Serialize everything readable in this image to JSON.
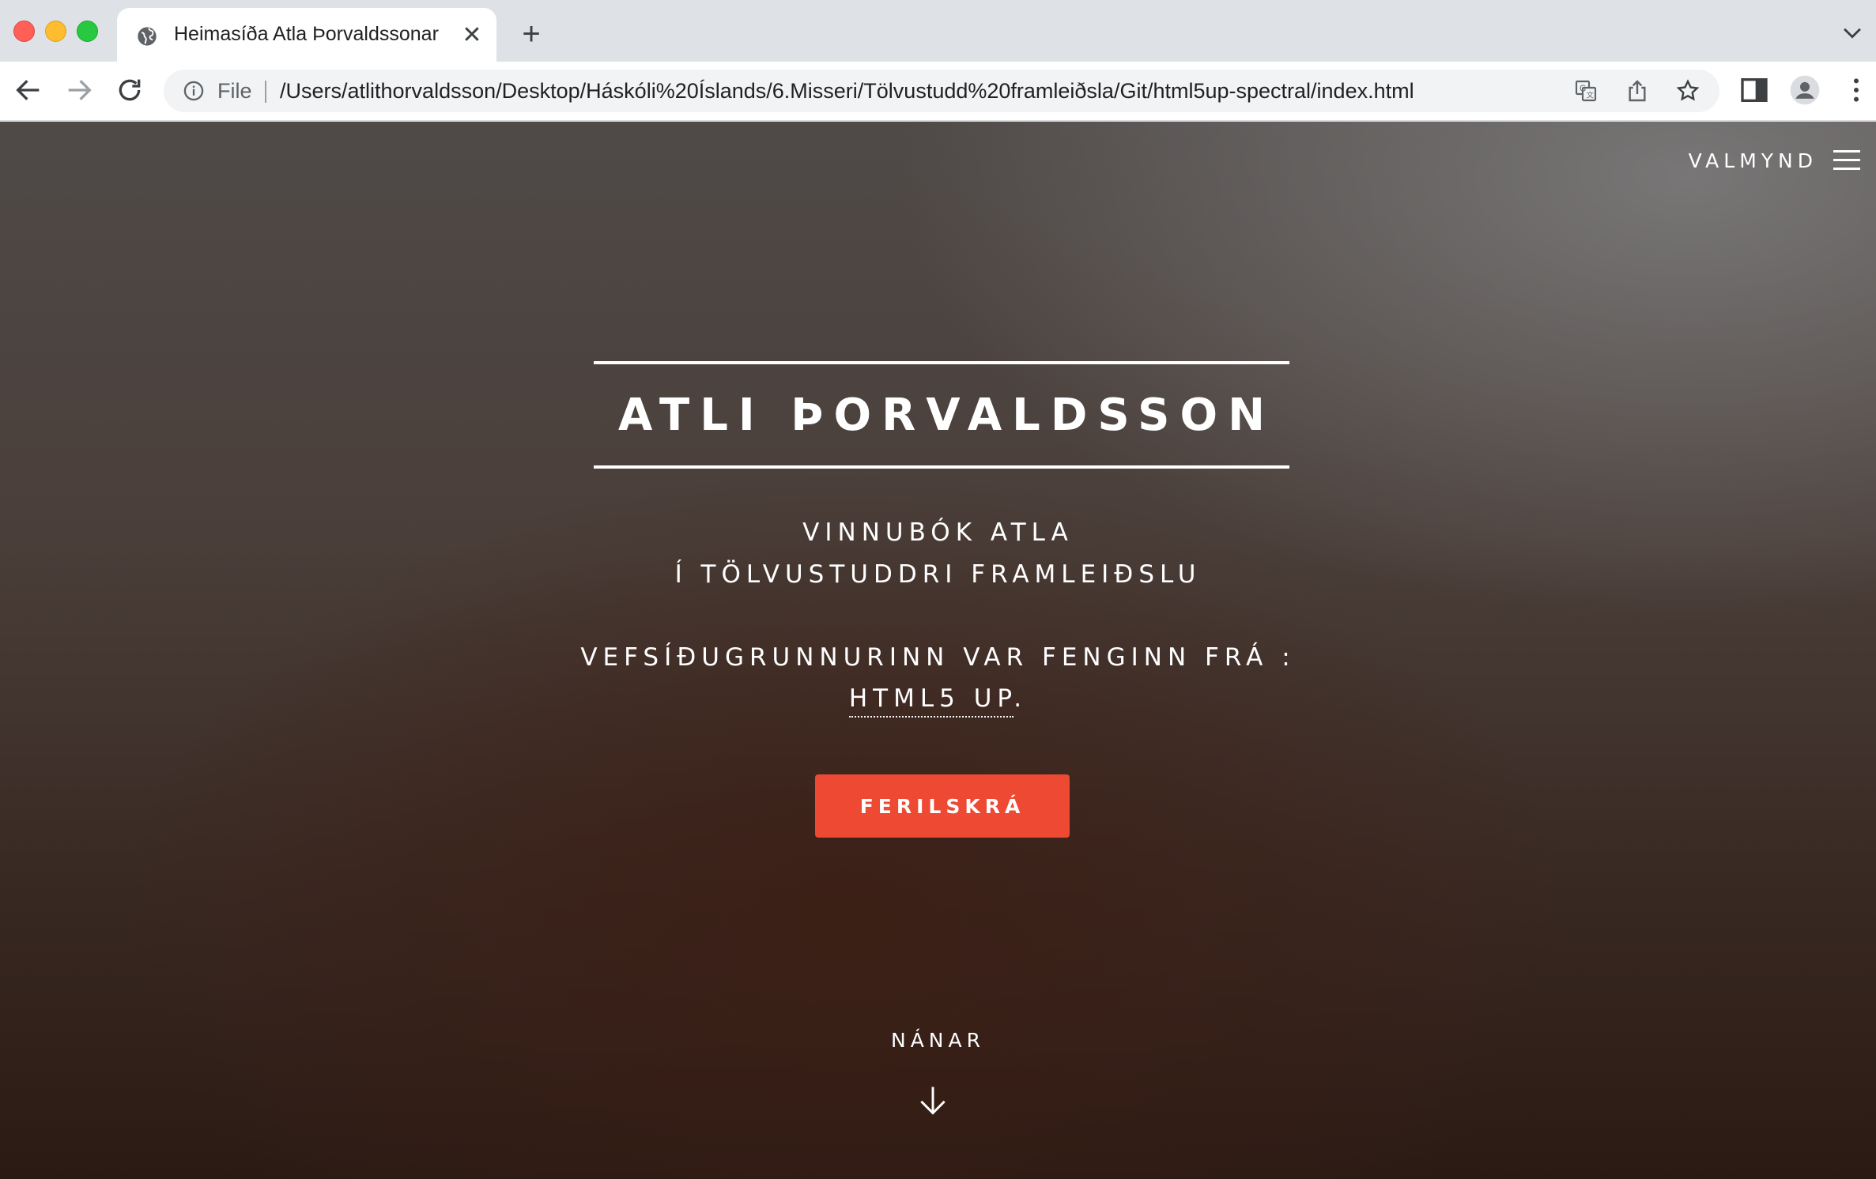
{
  "browser": {
    "tab_title": "Heimasíða Atla Þorvaldssonar",
    "tab_close": "✕",
    "new_tab": "+",
    "address_scheme": "File",
    "url": "/Users/atlithorvaldsson/Desktop/Háskóli%20Íslands/6.Misseri/Tölvustudd%20framleiðsla/Git/html5up-spectral/index.html",
    "icons": [
      "back-icon",
      "forward-icon",
      "reload-icon",
      "info-icon",
      "translate-icon",
      "share-icon",
      "bookmark-star-icon",
      "side-panel-icon",
      "profile-icon",
      "more-menu-icon",
      "tab-search-icon",
      "globe-icon"
    ]
  },
  "page": {
    "menu_label": "VALMYND",
    "title": "ATLI ÞORVALDSSON",
    "subtitle_line1": "VINNUBÓK ATLA",
    "subtitle_line2": "Í TÖLVUSTUDDRI FRAMLEIÐSLU",
    "credit_line1": "VEFSÍÐUGRUNNURINN VAR FENGINN FRÁ :",
    "credit_link": "HTML5 UP",
    "credit_end": ".",
    "cta_label": "FERILSKRÁ",
    "more_label": "NÁNAR",
    "colors": {
      "accent": "#ed4933",
      "text": "#ffffff"
    }
  }
}
